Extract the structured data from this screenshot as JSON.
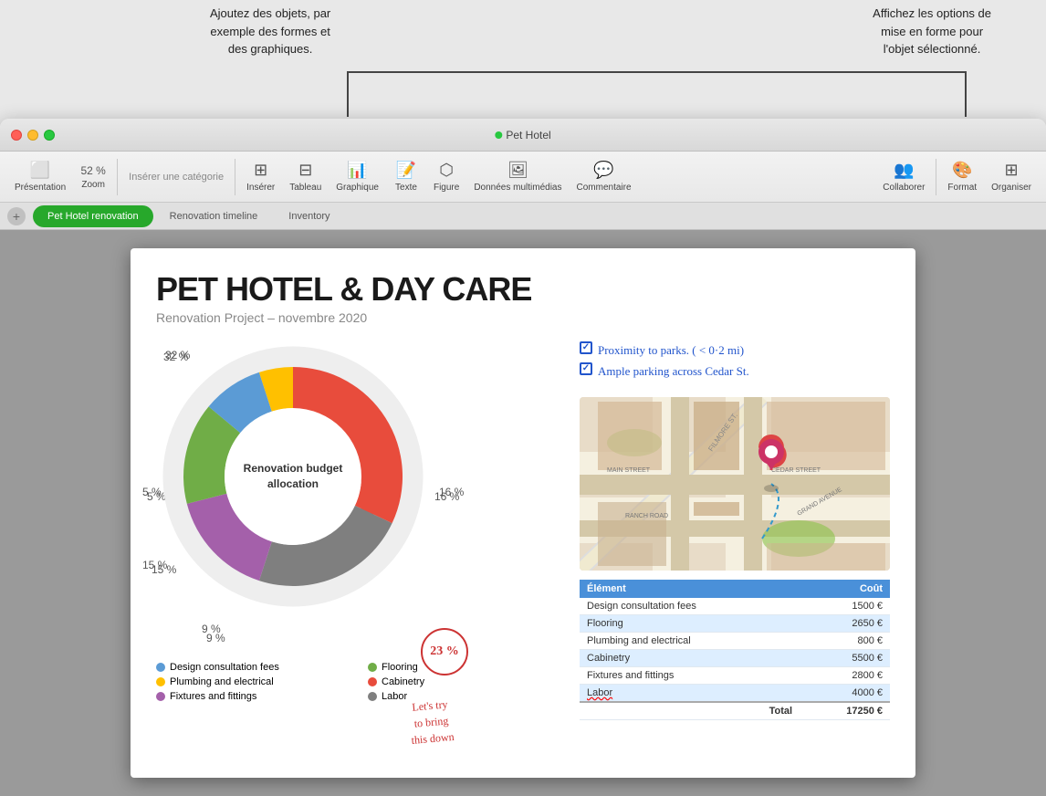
{
  "annotations": {
    "left": "Ajoutez des objets, par\nexemple des formes et\ndes graphiques.",
    "right": "Affichez les options de\nmise en forme pour\nl'objet sélectionné."
  },
  "window": {
    "title": "Pet Hotel"
  },
  "toolbar": {
    "presentation": "Présentation",
    "zoom": "Zoom",
    "zoom_val": "52 %",
    "insert_cat": "Insérer une catégorie",
    "insert": "Insérer",
    "table": "Tableau",
    "chart": "Graphique",
    "text": "Texte",
    "shape": "Figure",
    "media": "Données multimédias",
    "comment": "Commentaire",
    "collaborate": "Collaborer",
    "format": "Format",
    "organize": "Organiser"
  },
  "tabs": [
    {
      "label": "Pet Hotel renovation",
      "active": true
    },
    {
      "label": "Renovation timeline",
      "active": false
    },
    {
      "label": "Inventory",
      "active": false
    }
  ],
  "slide": {
    "title": "PET HOTEL & DAY CARE",
    "subtitle": "Renovation Project – novembre 2020",
    "chart": {
      "center_label": "Renovation budget\nallocation",
      "percentages": {
        "top_left": "32 %",
        "mid_left": "5 %",
        "bottom_left": "15 %",
        "bottom": "9 %",
        "right": "16 %",
        "circle_pct": "23 %"
      },
      "segments": [
        {
          "label": "Design consultation fees",
          "color": "#5b9bd5",
          "pct": 9
        },
        {
          "label": "Plumbing and electrical",
          "color": "#ffc000",
          "pct": 5
        },
        {
          "label": "Fixtures and fittings",
          "color": "#a460aa",
          "pct": 16
        },
        {
          "label": "Flooring",
          "color": "#70ad47",
          "pct": 15
        },
        {
          "label": "Cabinetry",
          "color": "#e84c3c",
          "pct": 32
        },
        {
          "label": "Labor",
          "color": "#7f7f7f",
          "pct": 23
        }
      ]
    },
    "handwriting": {
      "check1": "Proximity to parks. ( < 0·2 mi)",
      "check2": "Ample parking across  Cedar St.",
      "circle_text": "23 %",
      "lets_try": "Let's try\nto bring\nthis down"
    },
    "table": {
      "headers": [
        "Élément",
        "Coût"
      ],
      "rows": [
        {
          "item": "Design consultation fees",
          "cost": "1500 €",
          "highlight": false
        },
        {
          "item": "Flooring",
          "cost": "2650 €",
          "highlight": true
        },
        {
          "item": "Plumbing and electrical",
          "cost": "800 €",
          "highlight": false
        },
        {
          "item": "Cabinetry",
          "cost": "5500 €",
          "highlight": true
        },
        {
          "item": "Fixtures and fittings",
          "cost": "2800 €",
          "highlight": false
        },
        {
          "item": "Labor",
          "cost": "4000 €",
          "highlight": true,
          "underline": true
        }
      ],
      "total_label": "Total",
      "total_value": "17250 €"
    }
  }
}
